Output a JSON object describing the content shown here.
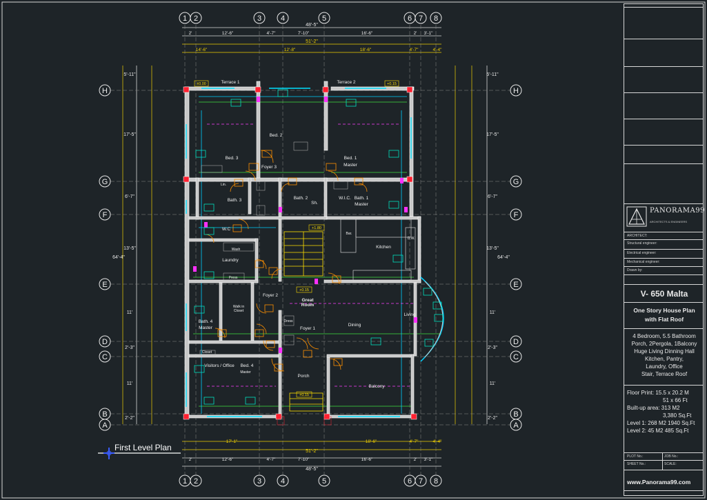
{
  "plan": {
    "title": "First Level Plan",
    "grid_columns": [
      "1",
      "2",
      "3",
      "4",
      "5",
      "6",
      "7",
      "8"
    ],
    "grid_rows": [
      "H",
      "G",
      "F",
      "E",
      "D",
      "C",
      "B",
      "A"
    ],
    "dims_top_total": "48'-5\"",
    "dims_top_row1": [
      "2'",
      "12'-6\"",
      "4'-7\"",
      "7'-10\"",
      "16'-6\"",
      "2'",
      "3'-1\""
    ],
    "dims_top_row2": "51'-2\"",
    "dims_top_row3": [
      "14'-6\"",
      "12'-8\"",
      "18'-6\"",
      "4'-7\"",
      "4'-4\""
    ],
    "dims_side": [
      "5'-11\"",
      "17'-5\"",
      "6'-7\"",
      "13'-5\"",
      "11'",
      "2'-3\"",
      "11'",
      "2'-2\""
    ],
    "dims_side_total": "64'-4\"",
    "dims_bottom_row1": [
      "17'-1\"",
      "18'-6\"",
      "4'-7\"",
      "4'-4\""
    ],
    "dims_bottom_row2": "51'-2\"",
    "dims_bottom_row3": [
      "2'",
      "12'-6\"",
      "4'-7\"",
      "7'-10\"",
      "16'-6\"",
      "2'",
      "3'-1\""
    ],
    "dims_bottom_total": "48'-5\"",
    "rooms": {
      "terrace1": "Terrace 1",
      "terrace2": "Terrace 2",
      "bed2": "Bed. 2",
      "bed3": "Bed. 3",
      "bed1": "Bed. 1",
      "bed1b": "Master",
      "foyer3": "Foyer 3",
      "bath3": "Bath. 3",
      "bath2": "Bath. 2",
      "bath1": "Bath. 1",
      "bath1b": "Master",
      "wic": "W.I.C.",
      "wc": "W.C",
      "laundry": "Laundry",
      "wash": "Wash",
      "press": "Press",
      "kitchen": "Kitchen",
      "bar": "Bar.",
      "foyer2": "Foyer 2",
      "great1": "Great",
      "great2": "Room",
      "walkin1": "Walk in",
      "walkin2": "Closet",
      "bath4": "Bath. 4",
      "bath4b": "Master",
      "living": "Living",
      "dining": "Dining",
      "foyer1": "Foyer 1",
      "office": "Visitors / Office",
      "bed4": "Bed. 4",
      "bed4b": "Master",
      "porch": "Porch",
      "balcony": "Balcony",
      "closet": "Closet",
      "lin": "Lin.",
      "dress": "Dress",
      "sh": "Sh.",
      "dw": "D.W."
    },
    "levels": [
      "±0.00",
      "+0.15",
      "+0.15",
      "+0.15",
      "+1.80"
    ]
  },
  "title_block": {
    "brand": "PANORAMA99",
    "brand_tag": "ARCHITECTS & ENGINEERS",
    "roles": [
      "ARCHITECT:",
      "Structural engineer:",
      "Electrical engineer:",
      "Mechanical engineer:",
      "Drawn by:"
    ],
    "project_code": "V- 650 Malta",
    "project_type_1": "One Story House Plan",
    "project_type_2": "with Flat Roof",
    "description": [
      "4 Bedroom, 5.5 Bathroom",
      "Porch, 2Pergola, 1Balcony",
      "Huge Living Dinning Hall",
      "Kitchen, Pantry,",
      "Laundry, Office",
      "Stair, Terrace Roof"
    ],
    "areas": [
      "Floor Print: 15.5 x 20.2 M",
      "51 x 66 Ft",
      "Built-up area: 313 M2",
      "3,380 Sq.Ft",
      "Level 1: 268 M2 1940 Sq.Ft",
      "Level 2:  45 M2   485 Sq.Ft"
    ],
    "plot_no": "PLOT No.:",
    "job_no": "JOB No.:",
    "sheet_no": "SHEET No.:",
    "scale": "SCALE:",
    "website": "www.Panorama99.com"
  }
}
